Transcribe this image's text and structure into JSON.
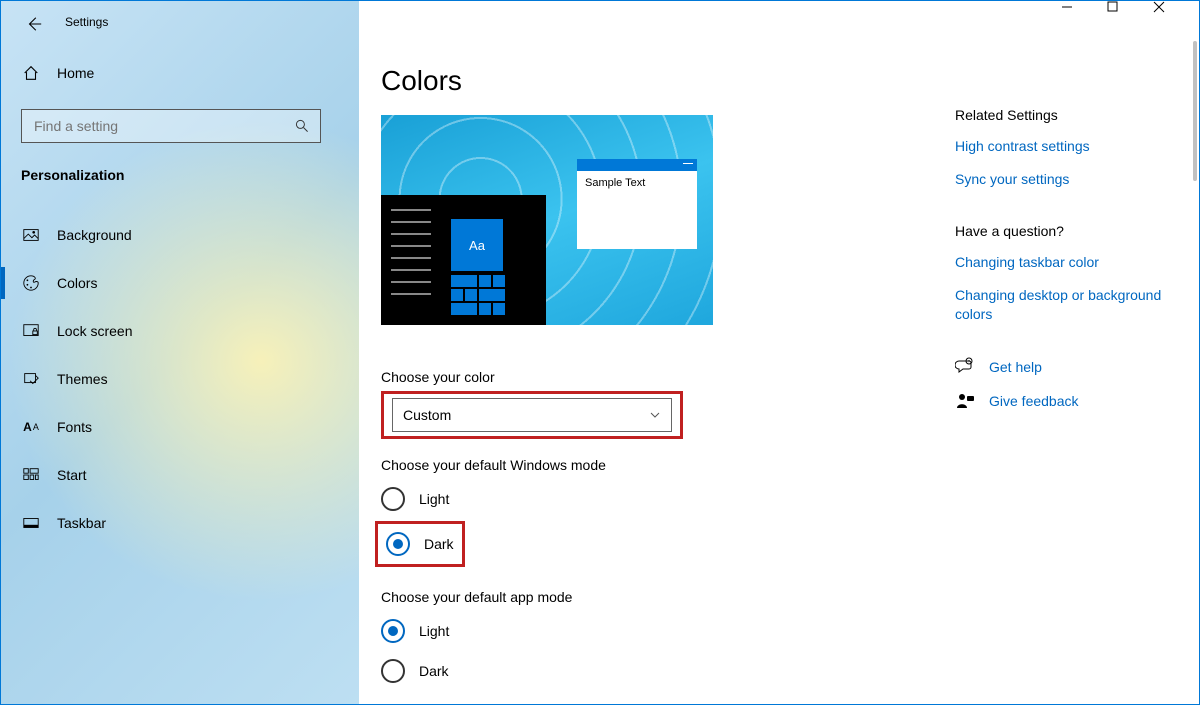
{
  "app_title": "Settings",
  "caption": {
    "minimize": "—",
    "maximize": "☐",
    "close": "✕"
  },
  "home_label": "Home",
  "search_placeholder": "Find a setting",
  "section_header": "Personalization",
  "nav": [
    {
      "key": "background",
      "label": "Background",
      "selected": false
    },
    {
      "key": "colors",
      "label": "Colors",
      "selected": true
    },
    {
      "key": "lock-screen",
      "label": "Lock screen",
      "selected": false
    },
    {
      "key": "themes",
      "label": "Themes",
      "selected": false
    },
    {
      "key": "fonts",
      "label": "Fonts",
      "selected": false
    },
    {
      "key": "start",
      "label": "Start",
      "selected": false
    },
    {
      "key": "taskbar",
      "label": "Taskbar",
      "selected": false
    }
  ],
  "page_title": "Colors",
  "preview": {
    "tile_text": "Aa",
    "sample_window_text": "Sample Text"
  },
  "choose_color": {
    "label": "Choose your color",
    "value": "Custom"
  },
  "windows_mode": {
    "label": "Choose your default Windows mode",
    "options": [
      {
        "label": "Light",
        "selected": false
      },
      {
        "label": "Dark",
        "selected": true
      }
    ]
  },
  "app_mode": {
    "label": "Choose your default app mode",
    "options": [
      {
        "label": "Light",
        "selected": true
      },
      {
        "label": "Dark",
        "selected": false
      }
    ]
  },
  "aside": {
    "related_header": "Related Settings",
    "related_links": [
      "High contrast settings",
      "Sync your settings"
    ],
    "question_header": "Have a question?",
    "question_links": [
      "Changing taskbar color",
      "Changing desktop or background colors"
    ],
    "support_links": [
      "Get help",
      "Give feedback"
    ]
  }
}
